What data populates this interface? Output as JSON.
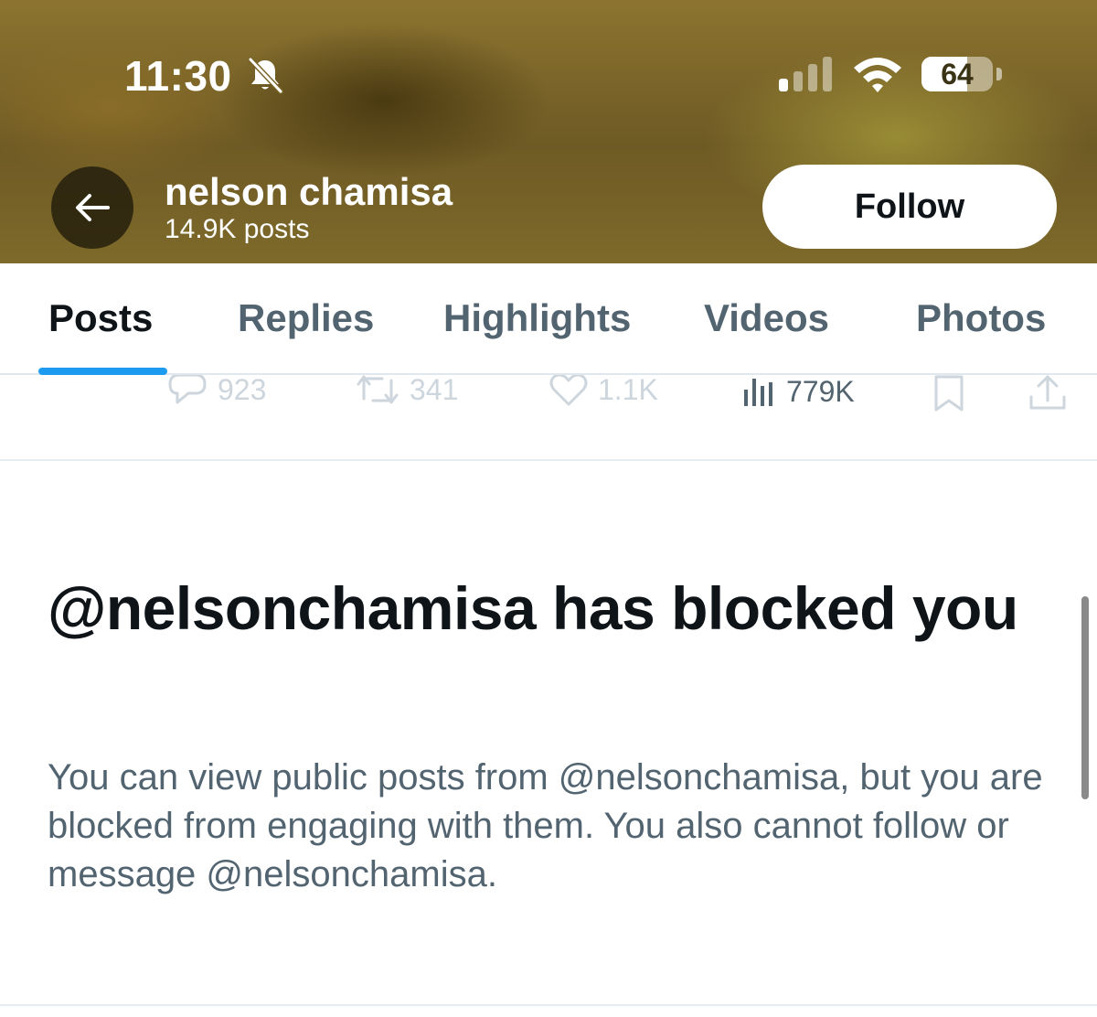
{
  "status_bar": {
    "time": "11:30",
    "battery_level": 64,
    "battery_label": "64"
  },
  "header": {
    "name": "nelson chamisa",
    "posts_count": "14.9K posts",
    "follow_label": "Follow"
  },
  "tabs": [
    {
      "label": "Posts",
      "active": true
    },
    {
      "label": "Replies",
      "active": false
    },
    {
      "label": "Highlights",
      "active": false
    },
    {
      "label": "Videos",
      "active": false
    },
    {
      "label": "Photos",
      "active": false
    }
  ],
  "engagement": {
    "replies": "923",
    "reposts": "341",
    "likes": "1.1K",
    "views": "779K"
  },
  "blocked": {
    "title": "@nelsonchamisa has blocked you",
    "description": "You can view public posts from @nelsonchamisa, but you are blocked from engaging with them. You also cannot follow or message @nelsonchamisa."
  },
  "colors": {
    "accent": "#1d9bf0",
    "header_tint": "#7e6a2a",
    "secondary_text": "#536471"
  }
}
